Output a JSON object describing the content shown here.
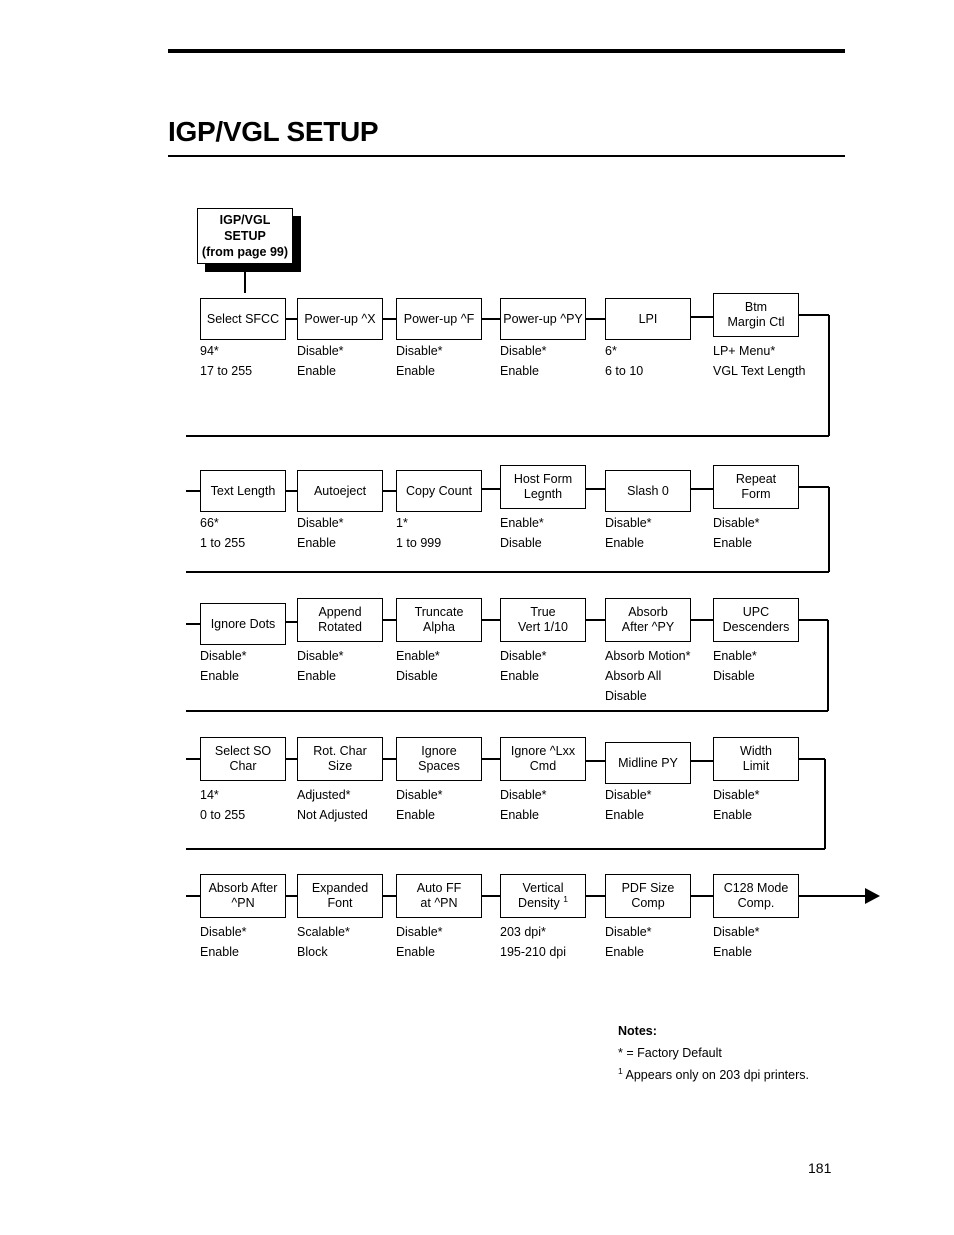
{
  "page": {
    "title": "IGP/VGL SETUP",
    "number": "181"
  },
  "chart_data": {
    "type": "diagram",
    "start": {
      "label": "IGP/VGL\nSETUP\n(from page 99)"
    },
    "rows": [
      {
        "nodes": [
          {
            "label": "Select SFCC",
            "options": "94*\n17 to 255"
          },
          {
            "label": "Power-up ^X",
            "options": "Disable*\nEnable"
          },
          {
            "label": "Power-up ^F",
            "options": "Disable*\nEnable"
          },
          {
            "label": "Power-up ^PY",
            "options": "Disable*\nEnable"
          },
          {
            "label": "LPI",
            "options": "6*\n6 to 10"
          },
          {
            "label": "Btm\nMargin Ctl",
            "options": "LP+ Menu*\nVGL Text Length"
          }
        ]
      },
      {
        "nodes": [
          {
            "label": "Text Length",
            "options": "66*\n1 to 255"
          },
          {
            "label": "Autoeject",
            "options": "Disable*\nEnable"
          },
          {
            "label": "Copy Count",
            "options": "1*\n1 to 999"
          },
          {
            "label": "Host Form\nLegnth",
            "options": "Enable*\nDisable"
          },
          {
            "label": "Slash 0",
            "options": "Disable*\nEnable"
          },
          {
            "label": "Repeat\nForm",
            "options": "Disable*\nEnable"
          }
        ]
      },
      {
        "nodes": [
          {
            "label": "Ignore Dots",
            "options": "Disable*\nEnable"
          },
          {
            "label": "Append\nRotated",
            "options": "Disable*\nEnable"
          },
          {
            "label": "Truncate\nAlpha",
            "options": "Enable*\nDisable"
          },
          {
            "label": "True\nVert 1/10",
            "options": "Disable*\nEnable"
          },
          {
            "label": "Absorb\nAfter ^PY",
            "options": "Absorb Motion*\nAbsorb All\nDisable"
          },
          {
            "label": "UPC\nDescenders",
            "options": "Enable*\nDisable"
          }
        ]
      },
      {
        "nodes": [
          {
            "label": "Select SO\nChar",
            "options": "14*\n0 to 255"
          },
          {
            "label": "Rot. Char\nSize",
            "options": "Adjusted*\nNot Adjusted"
          },
          {
            "label": "Ignore\nSpaces",
            "options": "Disable*\nEnable"
          },
          {
            "label": "Ignore ^Lxx\nCmd",
            "options": "Disable*\nEnable"
          },
          {
            "label": "Midline PY",
            "options": "Disable*\nEnable"
          },
          {
            "label": "Width\nLimit",
            "options": "Disable*\nEnable"
          }
        ]
      },
      {
        "nodes": [
          {
            "label": "Absorb After\n^PN",
            "options": "Disable*\nEnable"
          },
          {
            "label": "Expanded\nFont",
            "options": "Scalable*\nBlock"
          },
          {
            "label": "Auto FF\nat ^PN",
            "options": "Disable*\nEnable"
          },
          {
            "label": "Vertical\nDensity",
            "superscript": "1",
            "options": "203 dpi*\n195-210 dpi"
          },
          {
            "label": "PDF Size\nComp",
            "options": "Disable*\nEnable"
          },
          {
            "label": "C128 Mode\nComp.",
            "options": "Disable*\nEnable"
          }
        ]
      }
    ]
  },
  "notes": {
    "title": "Notes:",
    "line1": "* = Factory Default",
    "line2_sup": "1",
    "line2": " Appears only on 203 dpi printers."
  }
}
